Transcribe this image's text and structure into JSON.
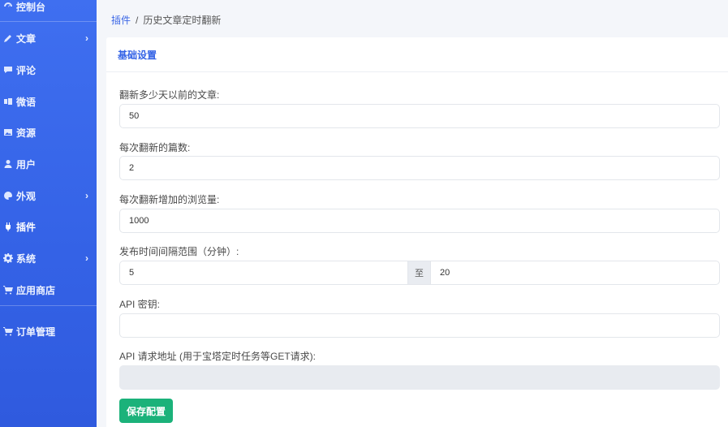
{
  "sidebar": {
    "items": [
      {
        "label": "控制台",
        "icon": "dashboard-icon",
        "chevron": ""
      },
      {
        "label": "文章",
        "icon": "pencil-icon",
        "chevron": "›"
      },
      {
        "label": "评论",
        "icon": "comment-icon",
        "chevron": ""
      },
      {
        "label": "微语",
        "icon": "microblog-icon",
        "chevron": ""
      },
      {
        "label": "资源",
        "icon": "image-icon",
        "chevron": ""
      },
      {
        "label": "用户",
        "icon": "user-icon",
        "chevron": ""
      },
      {
        "label": "外观",
        "icon": "palette-icon",
        "chevron": "›"
      },
      {
        "label": "插件",
        "icon": "plug-icon",
        "chevron": ""
      },
      {
        "label": "系统",
        "icon": "gear-icon",
        "chevron": "›"
      },
      {
        "label": "应用商店",
        "icon": "cart-icon",
        "chevron": ""
      },
      {
        "label": "订单管理",
        "icon": "cart-icon",
        "chevron": ""
      }
    ]
  },
  "breadcrumb": {
    "parent": "插件",
    "separator": "/",
    "current": "历史文章定时翻新"
  },
  "card": {
    "title": "基础设置"
  },
  "form": {
    "days_label": "翻新多少天以前的文章:",
    "days_value": "50",
    "count_label": "每次翻新的篇数:",
    "count_value": "2",
    "views_label": "每次翻新增加的浏览量:",
    "views_value": "1000",
    "interval_label": "发布时间间隔范围（分钟）:",
    "interval_from": "5",
    "interval_to_word": "至",
    "interval_to": "20",
    "api_key_label": "API 密钥:",
    "api_key_value": "",
    "api_url_label": "API 请求地址 (用于宝塔定时任务等GET请求):",
    "api_url_value": "",
    "save_label": "保存配置"
  },
  "colors": {
    "sidebar": "#3462e6",
    "accent": "#3463e6",
    "save": "#1bb27a"
  }
}
